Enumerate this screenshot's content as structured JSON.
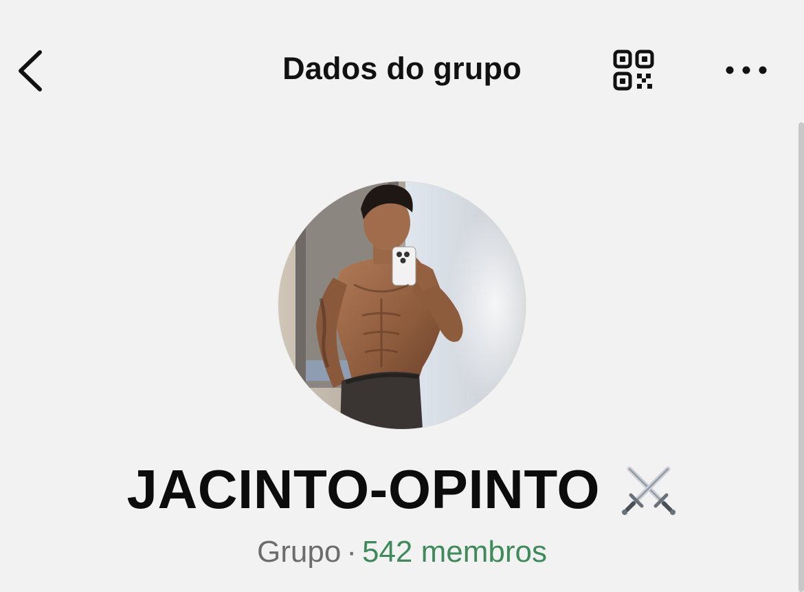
{
  "header": {
    "title": "Dados do grupo",
    "back_icon": "chevron-left-icon",
    "qr_icon": "qr-code-icon",
    "more_icon": "ellipsis-icon"
  },
  "group": {
    "name": "JACINTO-OPINTO",
    "name_emoji": "crossed-swords-icon",
    "type": "Grupo",
    "separator": "·",
    "members": "542 membros"
  },
  "colors": {
    "background": "#f2f2f2",
    "title": "#111111",
    "members_accent": "#3f8a5a",
    "secondary_text": "#6c6c6c"
  }
}
